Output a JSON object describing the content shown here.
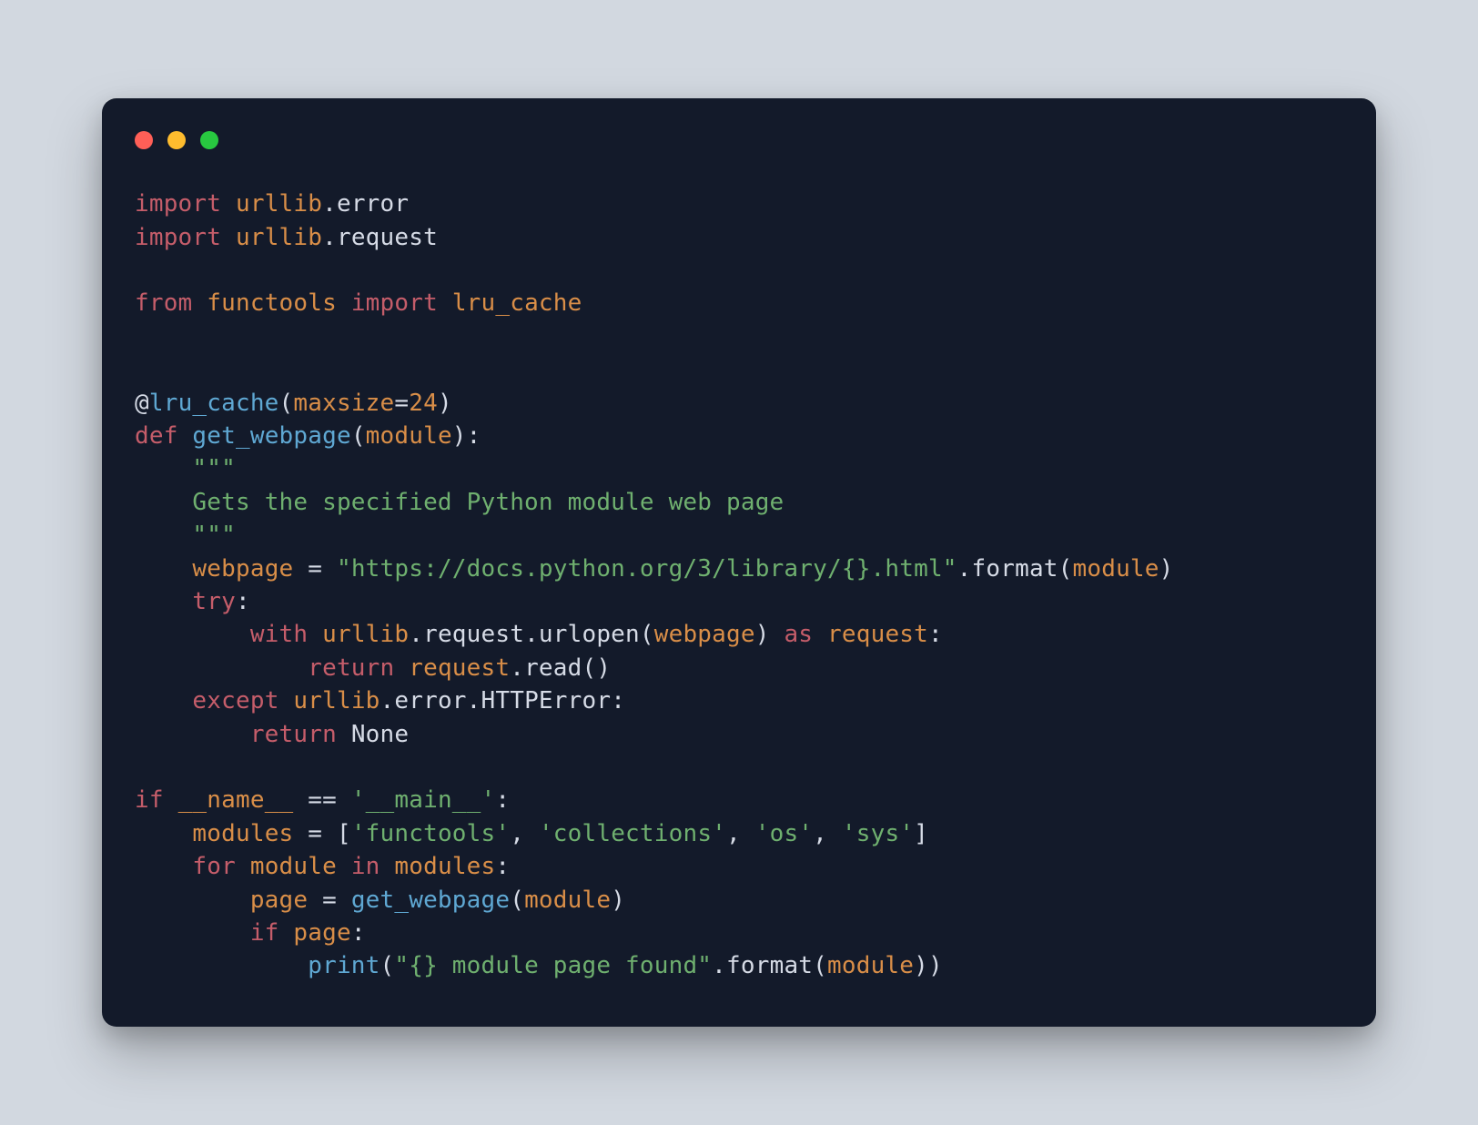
{
  "code": {
    "l1": {
      "kw_import": "import",
      "ident_urllib": "urllib",
      "attr_error": ".error"
    },
    "l2": {
      "kw_import": "import",
      "ident_urllib": "urllib",
      "attr_request": ".request"
    },
    "l3": {
      "kw_from": "from",
      "ident_functools": "functools",
      "kw_import": "import",
      "ident_lru_cache": "lru_cache"
    },
    "l4": {
      "deco_at": "@",
      "fn_lru_cache": "lru_cache",
      "lp": "(",
      "arg_maxsize": "maxsize",
      "eq": "=",
      "num_24": "24",
      "rp": ")"
    },
    "l5": {
      "kw_def": "def",
      "fn_get_webpage": "get_webpage",
      "lp": "(",
      "param_module": "module",
      "rp_colon": "):"
    },
    "l6": {
      "indent": "    ",
      "doc_open": "\"\"\""
    },
    "l7": {
      "indent": "    ",
      "doc_text": "Gets the specified Python module web page"
    },
    "l8": {
      "indent": "    ",
      "doc_close": "\"\"\""
    },
    "l9": {
      "indent": "    ",
      "var_webpage": "webpage",
      "eq": " = ",
      "str_url": "\"https://docs.python.org/3/library/{}.html\"",
      "dot_format": ".format",
      "lp": "(",
      "arg_module": "module",
      "rp": ")"
    },
    "l10": {
      "indent": "    ",
      "kw_try": "try",
      "colon": ":"
    },
    "l11": {
      "indent": "        ",
      "kw_with": "with",
      "ident_urllib": "urllib",
      "attr_request": ".request",
      "dot_urlopen": ".urlopen",
      "lp": "(",
      "arg_webpage": "webpage",
      "rp": ")",
      "kw_as": "as",
      "ident_request": "request",
      "colon": ":"
    },
    "l12": {
      "indent": "            ",
      "kw_return": "return",
      "ident_request": "request",
      "dot_read": ".read",
      "parens": "()"
    },
    "l13": {
      "indent": "    ",
      "kw_except": "except",
      "ident_urllib": "urllib",
      "attr_error": ".error",
      "attr_httperror": ".HTTPError",
      "colon": ":"
    },
    "l14": {
      "indent": "        ",
      "kw_return": "return",
      "none": "None"
    },
    "l15": {
      "kw_if": "if",
      "dunder_name": "__name__",
      "eqeq": " == ",
      "str_main": "'__main__'",
      "colon": ":"
    },
    "l16": {
      "indent": "    ",
      "var_modules": "modules",
      "eq": " = ",
      "lb": "[",
      "s1": "'functools'",
      "c1": ", ",
      "s2": "'collections'",
      "c2": ", ",
      "s3": "'os'",
      "c3": ", ",
      "s4": "'sys'",
      "rb": "]"
    },
    "l17": {
      "indent": "    ",
      "kw_for": "for",
      "var_module": "module",
      "kw_in": "in",
      "var_modules": "modules",
      "colon": ":"
    },
    "l18": {
      "indent": "        ",
      "var_page": "page",
      "eq": " = ",
      "fn_get_webpage": "get_webpage",
      "lp": "(",
      "arg_module": "module",
      "rp": ")"
    },
    "l19": {
      "indent": "        ",
      "kw_if": "if",
      "var_page": "page",
      "colon": ":"
    },
    "l20": {
      "indent": "            ",
      "fn_print": "print",
      "lp": "(",
      "str_found": "\"{} module page found\"",
      "dot_format": ".format",
      "lp2": "(",
      "arg_module": "module",
      "rp2": ")",
      "rp": ")"
    }
  },
  "colors": {
    "bg": "#131a2a",
    "page": "#d2d8e0",
    "keyword": "#c55d6a",
    "ident": "#d98e48",
    "fn": "#5fa8d3",
    "string": "#6fb06f",
    "text": "#e3e8ef"
  }
}
